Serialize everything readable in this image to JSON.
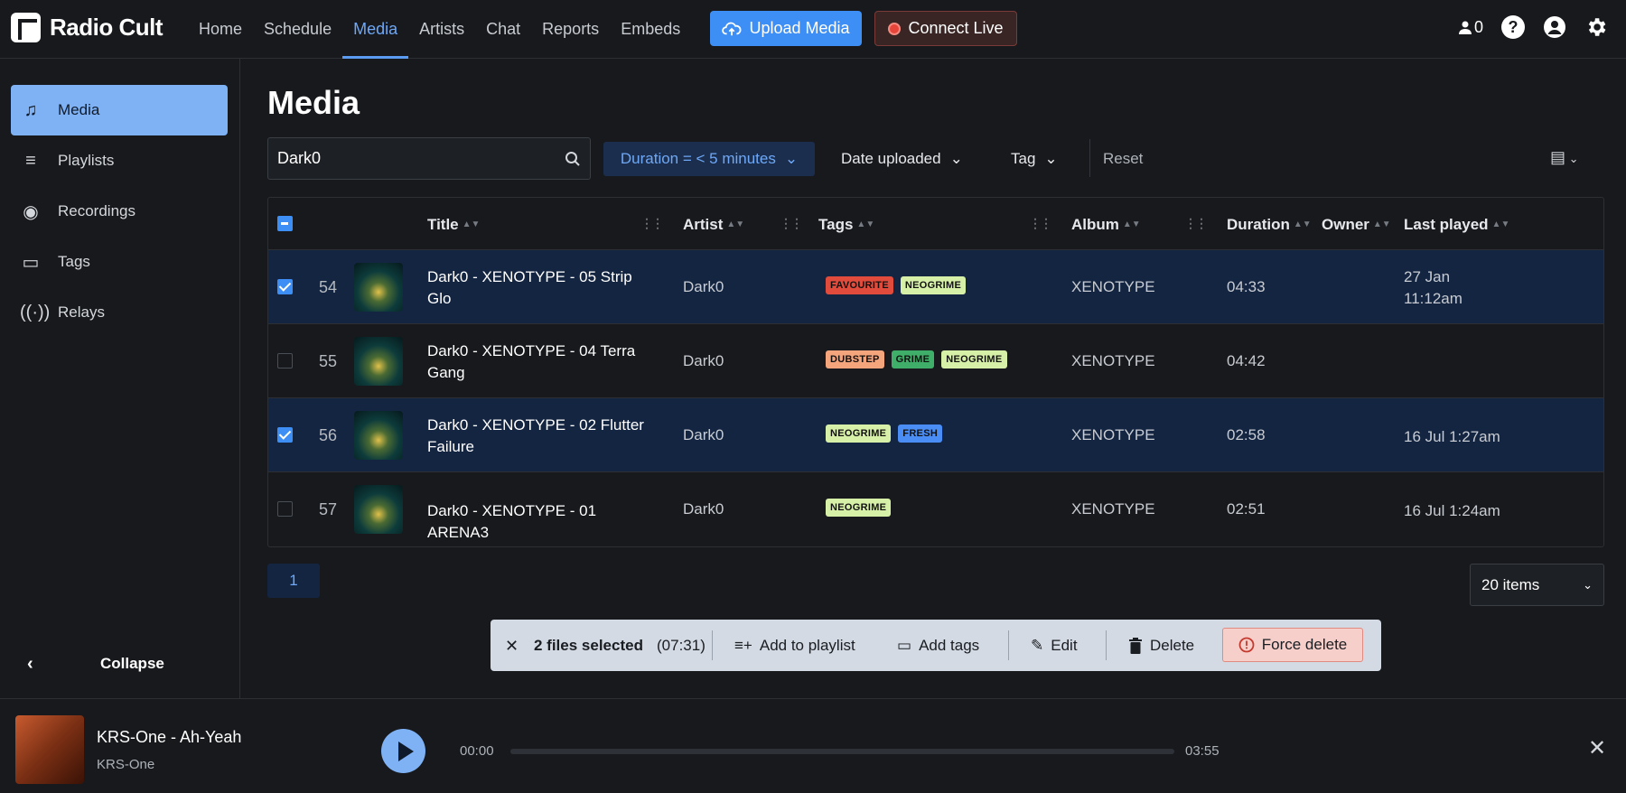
{
  "app": {
    "name": "Radio Cult"
  },
  "nav": {
    "items": [
      "Home",
      "Schedule",
      "Media",
      "Artists",
      "Chat",
      "Reports",
      "Embeds"
    ],
    "active": "Media"
  },
  "header": {
    "upload_label": "Upload Media",
    "live_label": "Connect Live",
    "listener_count": "0"
  },
  "sidebar": {
    "items": [
      {
        "label": "Media",
        "icon": "music-note-icon"
      },
      {
        "label": "Playlists",
        "icon": "playlist-icon"
      },
      {
        "label": "Recordings",
        "icon": "record-icon"
      },
      {
        "label": "Tags",
        "icon": "tag-icon"
      },
      {
        "label": "Relays",
        "icon": "broadcast-icon"
      }
    ],
    "collapse_label": "Collapse"
  },
  "page": {
    "title": "Media"
  },
  "filters": {
    "search_value": "Dark0",
    "duration": "Duration = < 5 minutes",
    "date": "Date uploaded",
    "tag": "Tag",
    "reset": "Reset"
  },
  "table": {
    "columns": [
      "Title",
      "Artist",
      "Tags",
      "Album",
      "Duration",
      "Owner",
      "Last played"
    ],
    "rows": [
      {
        "num": "54",
        "title": "Dark0 - XENOTYPE - 05 Strip Glo",
        "artist": "Dark0",
        "tags": [
          "FAVOURITE",
          "NEOGRIME"
        ],
        "album": "XENOTYPE",
        "duration": "04:33",
        "owner": "",
        "last_played": "27 Jan 11:12am",
        "selected": true
      },
      {
        "num": "55",
        "title": "Dark0 - XENOTYPE - 04 Terra Gang",
        "artist": "Dark0",
        "tags": [
          "DUBSTEP",
          "GRIME",
          "NEOGRIME"
        ],
        "album": "XENOTYPE",
        "duration": "04:42",
        "owner": "",
        "last_played": "",
        "selected": false
      },
      {
        "num": "56",
        "title": "Dark0 - XENOTYPE - 02 Flutter Failure",
        "artist": "Dark0",
        "tags": [
          "NEOGRIME",
          "FRESH"
        ],
        "album": "XENOTYPE",
        "duration": "02:58",
        "owner": "",
        "last_played": "16 Jul 1:27am",
        "selected": true
      },
      {
        "num": "57",
        "title": "Dark0 - XENOTYPE - 01 ARENA3",
        "artist": "Dark0",
        "tags": [
          "NEOGRIME"
        ],
        "album": "XENOTYPE",
        "duration": "02:51",
        "owner": "",
        "last_played": "16 Jul 1:24am",
        "selected": false
      }
    ]
  },
  "tag_colors": {
    "FAVOURITE": "#e14b3b",
    "NEOGRIME": "#d7f0a8",
    "DUBSTEP": "#f5a57c",
    "GRIME": "#3fae68",
    "FRESH": "#4a8ef5"
  },
  "pagination": {
    "page": "1",
    "items_per_page": "20 items"
  },
  "selection": {
    "count_text": "2 files selected",
    "duration": "(07:31)",
    "add_playlist": "Add to playlist",
    "add_tags": "Add tags",
    "edit": "Edit",
    "delete": "Delete",
    "force_delete": "Force delete"
  },
  "player": {
    "title": "KRS-One - Ah-Yeah",
    "artist": "KRS-One",
    "current_time": "00:00",
    "total_time": "03:55",
    "progress": 0
  }
}
